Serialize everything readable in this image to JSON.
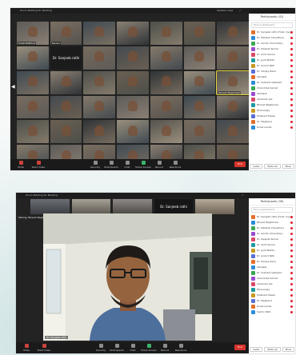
{
  "screenshot1": {
    "window_title": "Zoom Meeting ID: Meeting",
    "view_button": "Speaker View",
    "pinned_label": "Dr. Sanjeeb rathi",
    "active_speaker_label": "Bharat Waghmare",
    "panel_header": "Participants (41)",
    "search_placeholder": "Find a participant",
    "tile_names": [
      "Vivek Ratthod",
      "Kausal",
      "",
      "",
      "",
      "",
      "",
      "",
      "Dr. Sanjeeb rathi",
      "",
      "",
      "",
      "",
      "",
      "",
      "",
      "",
      "",
      "",
      "",
      "Bharat Waghmare",
      "",
      "",
      "",
      "",
      "",
      "",
      "",
      "",
      "",
      "",
      "",
      "",
      "",
      "",
      "",
      "",
      "",
      "",
      "",
      "",
      ""
    ],
    "participants": [
      "Dr. Sanjeeb rathi (Host, me)",
      "Dr. Mahesh Chaudhary",
      "Dr. Sachin Chaudhary",
      "Dr. Deepak Kumar",
      "Dr. Amit Verma",
      "Dr. Jyoti Mehta",
      "Dr. Anand Patil",
      "Dr. Sanjay Rana",
      "Abhijeet",
      "Dr. Sushant Gaikwad",
      "Chandrika Kamat",
      "Abhilash",
      "Ashutosh Jha",
      "Bharat Waghmare",
      "Dhananjay",
      "Prashant Pawar",
      "Dr. Meghana",
      "Kunal Lande"
    ],
    "footer_buttons": [
      "Invite",
      "Mute All",
      "More"
    ],
    "toolbar": [
      "Mute",
      "Start Video",
      "Security",
      "Participants",
      "Chat",
      "Share Screen",
      "Record",
      "Reactions"
    ],
    "end_button": "End"
  },
  "screenshot2": {
    "window_title": "Zoom Meeting ID: Meeting",
    "panel_header": "Participants (39)",
    "search_placeholder": "Find a participant",
    "strip_dark_label": "Dr. Sanjeeb rathi",
    "speaker_label": "Talking: Bharat Waghmare",
    "speaker_name": "Dr. Sanjeeb rathi",
    "participants": [
      "Dr. Sanjeeb rathi (Host, me)",
      "Bharat Waghmare",
      "Dr. Mahesh Chaudhary",
      "Dr. Sachin Chaudhary",
      "Dr. Deepak Kumar",
      "Dr. Amit Verma",
      "Dr. Jyoti Mehta",
      "Dr. Anand Patil",
      "Dr. Sanjay Rana",
      "Abhijeet",
      "Dr. Sushant Gaikwad",
      "Chandrika Kamat",
      "Ashutosh Jha",
      "Dhananjay",
      "Prashant Pawar",
      "Dr. Meghana",
      "Kunal Lande",
      "Sachin Patil"
    ],
    "footer_buttons": [
      "Invite",
      "Mute All",
      "More"
    ],
    "toolbar": [
      "Mute",
      "Start Video",
      "Security",
      "Participants",
      "Chat",
      "Share Screen",
      "Record",
      "Reactions"
    ],
    "end_button": "End"
  },
  "colors": {
    "zoom_bg": "#232323",
    "end_red": "#d8342c",
    "active_outline": "#e4d33a",
    "panel_bg": "#ffffff"
  }
}
